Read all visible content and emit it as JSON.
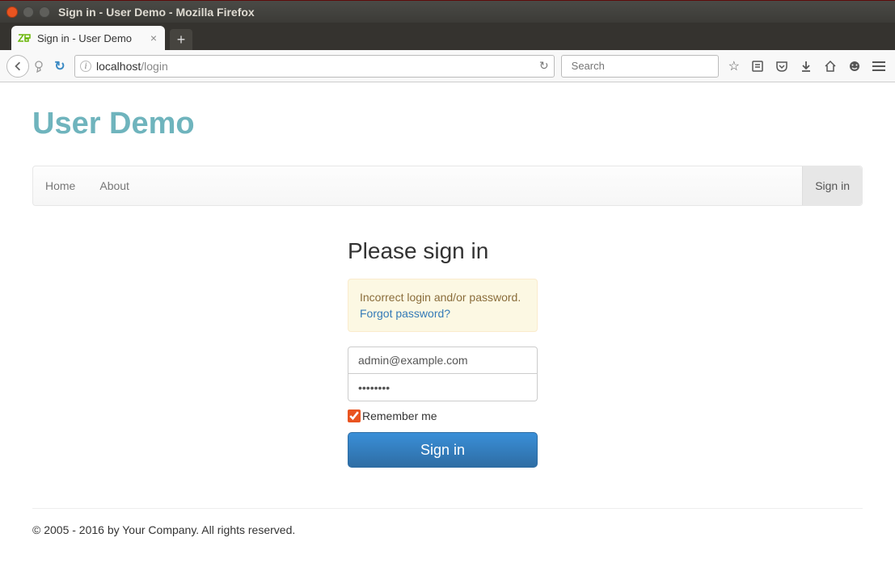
{
  "window": {
    "title": "Sign in - User Demo - Mozilla Firefox"
  },
  "tab": {
    "title": "Sign in - User Demo"
  },
  "url": {
    "host": "localhost",
    "path": "/login"
  },
  "search": {
    "placeholder": "Search"
  },
  "brand": "User Demo",
  "nav": {
    "home": "Home",
    "about": "About",
    "signin": "Sign in"
  },
  "form": {
    "heading": "Please sign in",
    "error": "Incorrect login and/or password.",
    "forgot": "Forgot password?",
    "email": "admin@example.com",
    "password": "••••••••",
    "remember_label": "Remember me",
    "submit": "Sign in"
  },
  "footer": "© 2005 - 2016 by Your Company. All rights reserved."
}
